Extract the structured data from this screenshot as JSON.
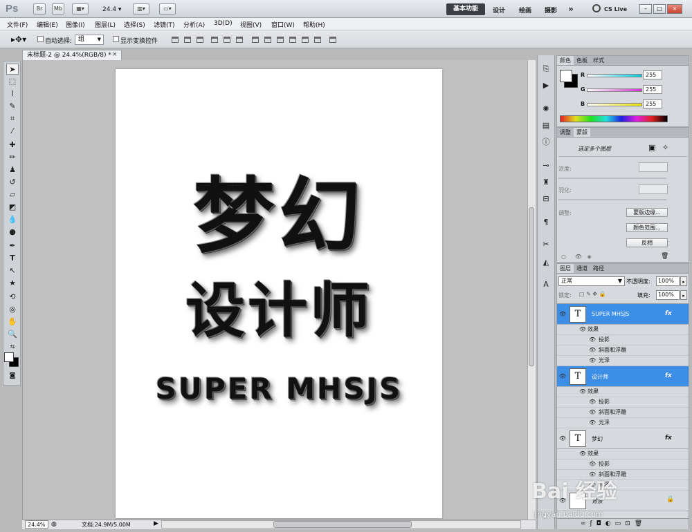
{
  "appbar": {
    "logo": "Ps",
    "btn_br": "Br",
    "btn_mb": "Mb",
    "zoom": "24.4",
    "workspace_active": "基本功能",
    "workspaces": [
      "设计",
      "绘画",
      "摄影"
    ],
    "more": "»",
    "cslive": "CS Live",
    "win_min": "–",
    "win_restore": "□",
    "win_close": "×"
  },
  "menu": [
    "文件(F)",
    "编辑(E)",
    "图像(I)",
    "图层(L)",
    "选择(S)",
    "滤镜(T)",
    "分析(A)",
    "3D(D)",
    "视图(V)",
    "窗口(W)",
    "帮助(H)"
  ],
  "options": {
    "auto_select_label": "自动选择:",
    "auto_select_value": "组",
    "transform_label": "显示变换控件"
  },
  "document": {
    "tab_title": "未标题-2 @ 24.4%(RGB/8) *",
    "tab_close": "×",
    "line1": "梦幻",
    "line2": "设计师",
    "line3": "SUPER MHSJS"
  },
  "status": {
    "zoom": "24.4%",
    "docinfo": "文档:24.9M/5.00M"
  },
  "color_panel": {
    "tabs": [
      "颜色",
      "色板",
      "样式"
    ],
    "r_label": "R",
    "g_label": "G",
    "b_label": "B",
    "r": "255",
    "g": "255",
    "b": "255",
    "color_r": "#00c8e0",
    "color_g": "#d030d0",
    "color_b": "#e8e000"
  },
  "masks_panel": {
    "tabs": [
      "调整",
      "蒙版"
    ],
    "message": "选定多个图层",
    "density_label": "浓度:",
    "feather_label": "羽化:",
    "refine_label": "调整:",
    "btn_edge": "蒙版边缘...",
    "btn_range": "颜色范围...",
    "btn_invert": "反相"
  },
  "layers_panel": {
    "tabs": [
      "图层",
      "通道",
      "路径"
    ],
    "blend_mode": "正常",
    "opacity_label": "不透明度:",
    "opacity": "100%",
    "lock_label": "锁定:",
    "fill_label": "填充:",
    "fill": "100%",
    "effects_label": "效果",
    "fx_shadow": "投影",
    "fx_bevel": "斜面和浮雕",
    "fx_satin": "光泽",
    "layer1_name": "SUPER MHSJS",
    "layer2_name": "设计师",
    "layer3_name": "梦幻",
    "layer4_name": "背景",
    "thumb_letter": "T",
    "fx_badge": "fx"
  },
  "watermark": {
    "brand": "Bai 经验",
    "url": "jingyan.baidu.com"
  }
}
